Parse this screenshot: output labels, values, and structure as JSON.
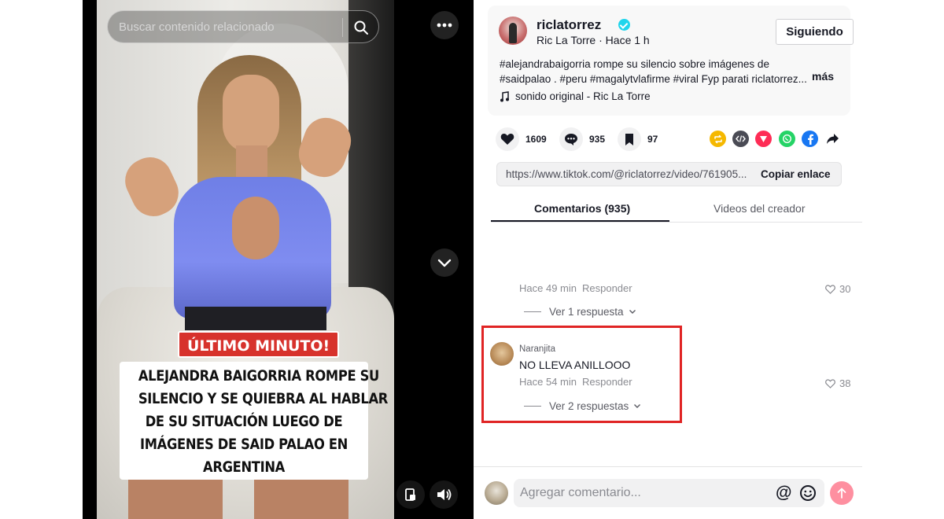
{
  "video": {
    "search_placeholder": "Buscar contenido relacionado",
    "caption_tag": "ÚLTIMO MINUTO!",
    "caption_lines": [
      "ALEJANDRA BAIGORRIA ROMPE SU",
      "SILENCIO Y SE QUIEBRA AL HABLAR",
      "DE SU SITUACIÓN LUEGO DE",
      "IMÁGENES DE SAID PALAO EN",
      "ARGENTINA"
    ],
    "icons": [
      "search-icon",
      "more-options-icon",
      "chevron-down-icon",
      "pip-icon",
      "volume-icon"
    ]
  },
  "author": {
    "username": "riclatorrez",
    "verified": true,
    "display_name": "Ric La Torre",
    "separator": " · ",
    "time_ago": "Hace 1 h",
    "follow_label": "Siguiendo"
  },
  "description": {
    "lines": [
      "#alejandrabaigorria rompe su silencio sobre imágenes de",
      "#saidpalao . #peru #magalytvlafirme #viral Fyp parati riclatorrez..."
    ],
    "more_label": "más",
    "music": "sonido original - Ric La Torre"
  },
  "actions": {
    "likes": "1609",
    "comments": "935",
    "saves": "97"
  },
  "share": {
    "icons": [
      "repost-icon",
      "embed-icon",
      "send-icon",
      "whatsapp-icon",
      "facebook-icon",
      "share-arrow-icon"
    ],
    "colors": {
      "repost": "#f5b800",
      "embed": "#4a4b55",
      "send": "#fe2c55",
      "whatsapp": "#25d366",
      "facebook": "#1877f2",
      "arrow": "#161823"
    }
  },
  "link": {
    "url": "https://www.tiktok.com/@riclatorrez/video/761905...",
    "copy_label": "Copiar enlace"
  },
  "tabs": {
    "comments": "Comentarios (935)",
    "creator_videos": "Videos del creador"
  },
  "comments": [
    {
      "time": "Hace 49 min",
      "reply_label": "Responder",
      "likes": "30",
      "view_replies": "Ver 1 respuesta"
    },
    {
      "user": "Naranjita",
      "text": "NO LLEVA ANILLOOO",
      "time": "Hace 54 min",
      "reply_label": "Responder",
      "likes": "38",
      "view_replies": "Ver 2 respuestas"
    }
  ],
  "composer": {
    "placeholder": "Agregar comentario...",
    "mention_symbol": "@"
  },
  "colors": {
    "highlight_border": "#e02424",
    "post_button": "#fe8fa0",
    "caption_tag_bg": "#d7322c",
    "verified": "#20d5ec"
  }
}
